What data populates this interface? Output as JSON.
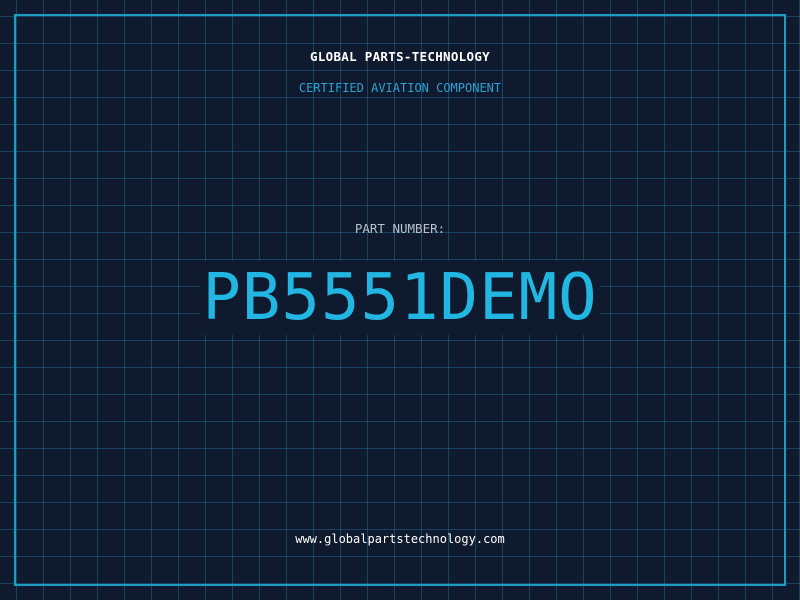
{
  "header": {
    "company_name": "GLOBAL PARTS-TECHNOLOGY",
    "subtitle": "CERTIFIED AVIATION COMPONENT"
  },
  "main": {
    "part_label": "PART NUMBER:",
    "part_number": "PB5551DEMO"
  },
  "footer": {
    "website": "www.globalpartstechnology.com"
  },
  "colors": {
    "background": "#101a2e",
    "grid": "#1d6884",
    "frame": "#1e9cc4",
    "accent": "#22b6e3",
    "subtitle": "#2aa3d3",
    "label": "#b7c2cd",
    "text": "#ffffff"
  }
}
